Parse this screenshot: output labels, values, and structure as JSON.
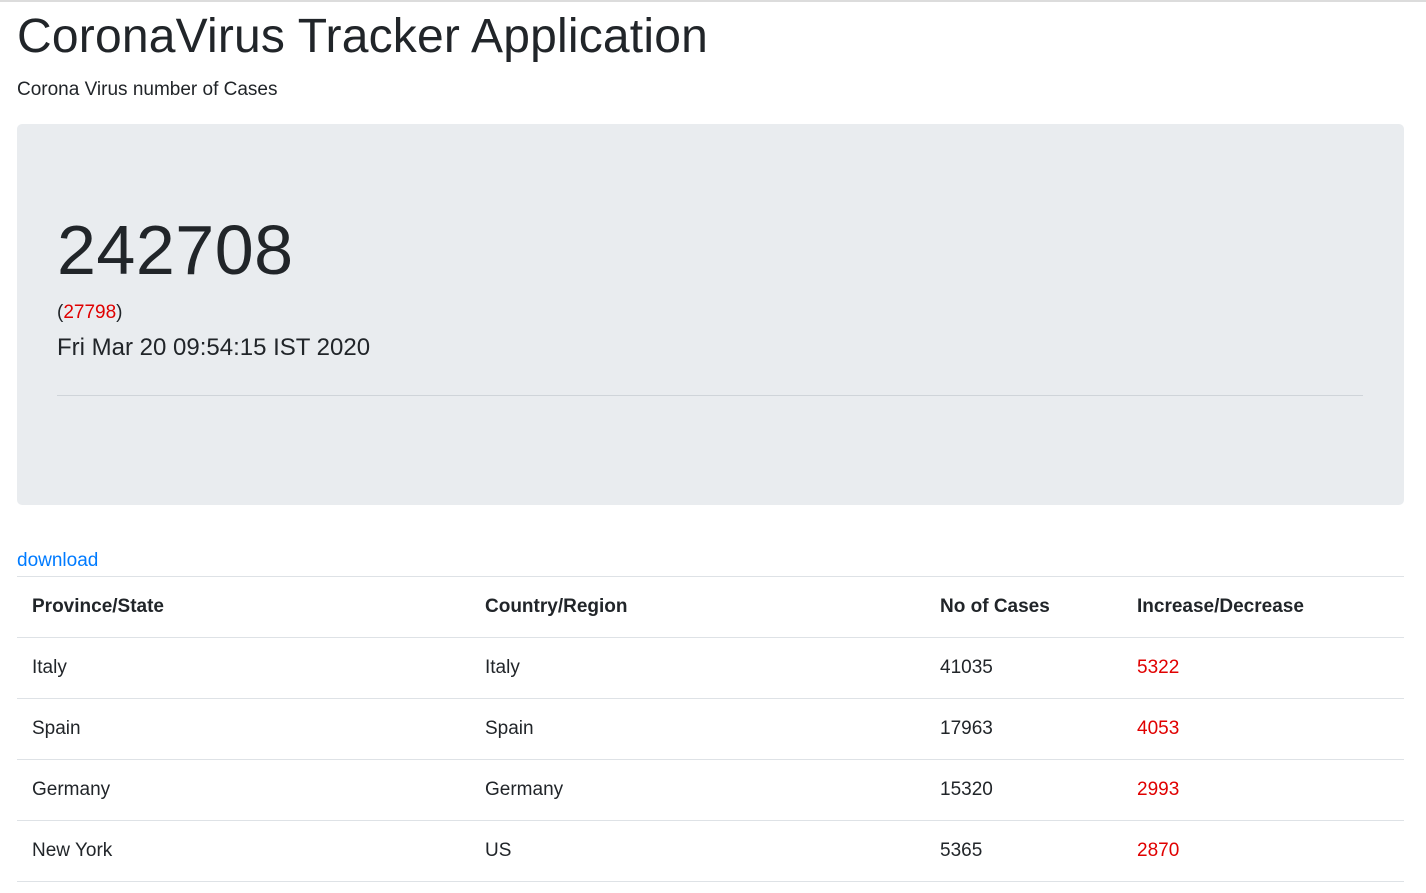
{
  "header": {
    "title": "CoronaVirus Tracker Application",
    "subtitle": "Corona Virus number of Cases"
  },
  "summary": {
    "total_cases": "242708",
    "open_paren": "(",
    "daily_change": "27798",
    "close_paren": ")",
    "timestamp": "Fri Mar 20 09:54:15 IST 2020"
  },
  "download_link": "download",
  "table": {
    "headers": [
      "Province/State",
      "Country/Region",
      "No of Cases",
      "Increase/Decrease"
    ],
    "rows": [
      [
        "Italy",
        "Italy",
        "41035",
        "5322"
      ],
      [
        "Spain",
        "Spain",
        "17963",
        "4053"
      ],
      [
        "Germany",
        "Germany",
        "15320",
        "2993"
      ],
      [
        "New York",
        "US",
        "5365",
        "2870"
      ]
    ]
  },
  "colors": {
    "change_text": "#e00000",
    "link": "#007bff",
    "jumbotron_bg": "#e9ecef"
  }
}
